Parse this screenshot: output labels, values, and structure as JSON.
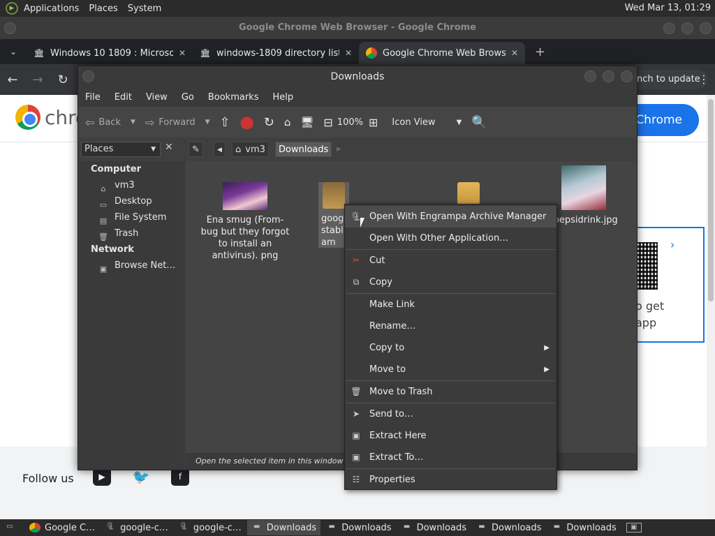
{
  "top_panel": {
    "menus": [
      "Applications",
      "Places",
      "System"
    ],
    "clock": "Wed Mar 13, 01:29"
  },
  "chrome": {
    "window_title": "Google Chrome Web Browser - Google Chrome",
    "tabs": [
      {
        "label": "Windows 10 1809 : Microsoft",
        "icon": "archive-icon"
      },
      {
        "label": "windows-1809 directory listi",
        "icon": "archive-icon"
      },
      {
        "label": "Google Chrome Web Browse",
        "icon": "chrome-icon"
      }
    ],
    "update_pill": "nch to update",
    "page": {
      "brand_word": "chro",
      "get_chrome_button": "Chrome",
      "qr_text": "o get\napp",
      "follow_us": "Follow us",
      "social_icons": [
        "youtube-icon",
        "twitter-icon",
        "facebook-icon"
      ]
    }
  },
  "file_manager": {
    "title": "Downloads",
    "menubar": [
      "File",
      "Edit",
      "View",
      "Go",
      "Bookmarks",
      "Help"
    ],
    "toolbar": {
      "back": "Back",
      "forward": "Forward",
      "zoom": "100%",
      "view_mode": "Icon View"
    },
    "places_label": "Places",
    "breadcrumb": [
      "vm3",
      "Downloads"
    ],
    "sidebar": {
      "computer_header": "Computer",
      "computer_items": [
        "vm3",
        "Desktop",
        "File System",
        "Trash"
      ],
      "network_header": "Network",
      "network_items": [
        "Browse Net…"
      ]
    },
    "files": [
      {
        "name": "Ena smug (From- bug but they forgot to install an antivirus). png"
      },
      {
        "name": "goog\nstabl\nam"
      },
      {
        "name": ""
      },
      {
        "name": "rpepsidrink.jpg"
      }
    ],
    "status": "Open the selected item in this window"
  },
  "context_menu": {
    "items": [
      {
        "label": "Open With Engrampa Archive Manager",
        "icon": "archive-manager-icon"
      },
      {
        "label": "Open With Other Application…",
        "icon": ""
      },
      {
        "label": "Cut",
        "icon": "scissors-icon"
      },
      {
        "label": "Copy",
        "icon": "copy-icon"
      },
      {
        "label": "Make Link",
        "icon": ""
      },
      {
        "label": "Rename…",
        "icon": ""
      },
      {
        "label": "Copy to",
        "icon": ""
      },
      {
        "label": "Move to",
        "icon": ""
      },
      {
        "label": "Move to Trash",
        "icon": "trash-icon"
      },
      {
        "label": "Send to…",
        "icon": "send-icon"
      },
      {
        "label": "Extract Here",
        "icon": "extract-icon"
      },
      {
        "label": "Extract To…",
        "icon": "extract-icon"
      },
      {
        "label": "Properties",
        "icon": "properties-icon"
      }
    ]
  },
  "taskbar": {
    "items": [
      {
        "label": "Google C…",
        "icon": "chrome-icon"
      },
      {
        "label": "google-c…",
        "icon": "archive-manager-icon"
      },
      {
        "label": "google-c…",
        "icon": "archive-manager-icon"
      },
      {
        "label": "Downloads",
        "icon": "folder-icon"
      },
      {
        "label": "Downloads",
        "icon": "folder-icon"
      },
      {
        "label": "Downloads",
        "icon": "folder-icon"
      },
      {
        "label": "Downloads",
        "icon": "folder-icon"
      },
      {
        "label": "Downloads",
        "icon": "folder-icon"
      }
    ]
  }
}
